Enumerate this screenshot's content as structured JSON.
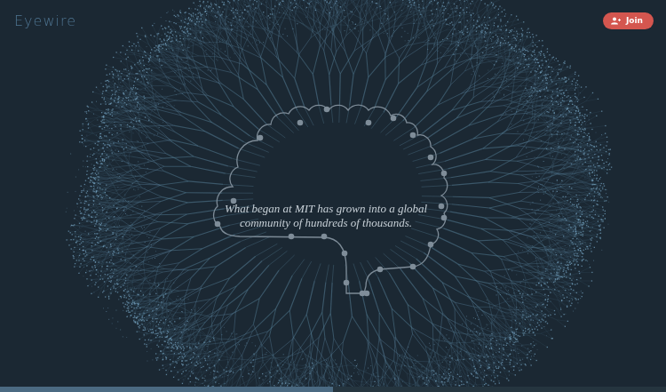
{
  "header": {
    "logo": "Eyewire",
    "join_button": "Join"
  },
  "caption": "What began at MIT has grown into a global community of hundreds of thousands.",
  "progress": {
    "level": 0.5
  }
}
